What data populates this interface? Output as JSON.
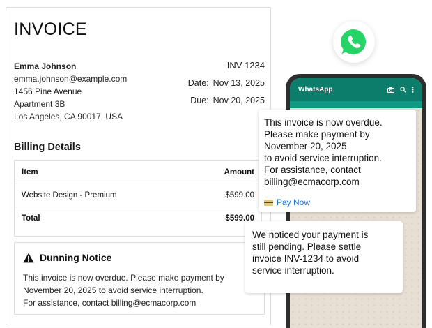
{
  "invoice": {
    "title": "INVOICE",
    "customer": {
      "name": "Emma Johnson",
      "email": "emma.johnson@example.com",
      "address1": "1456 Pine Avenue",
      "address2": "Apartment 3B",
      "city": "Los Angeles, CA 90017, USA"
    },
    "number": "INV-1234",
    "date_label": "Date:",
    "date": "Nov 13, 2025",
    "due_label": "Due:",
    "due": "Nov 20, 2025",
    "billing_heading": "Billing Details",
    "table": {
      "headers": [
        "Item",
        "Amount"
      ],
      "rows": [
        [
          "Website Design - Premium",
          "$599.00"
        ]
      ],
      "total_label": "Total",
      "total_value": "$599.00"
    },
    "notice": {
      "title": "Dunning Notice",
      "lines": [
        "This invoice is now overdue. Please make payment by",
        "November 20, 2025 to avoid service interruption.",
        "For assistance, contact billing@ecmacorp.com"
      ]
    }
  },
  "whatsapp": {
    "app_title": "WhatsApp",
    "icons": [
      "whatsapp-logo-icon",
      "camera-icon",
      "search-icon",
      "more-vert-icon"
    ],
    "accent": "#0b7d6a",
    "messages": [
      {
        "lines": [
          "This invoice is now overdue.",
          "Please make payment by",
          "November 20, 2025",
          "to avoid service interruption.",
          "For assistance, contact",
          "billing@ecmacorp.com"
        ],
        "action_label": "Pay Now"
      },
      {
        "lines": [
          "We noticed your payment is",
          "still pending. Please settle",
          "invoice INV-1234 to avoid",
          "service interruption."
        ]
      }
    ]
  }
}
